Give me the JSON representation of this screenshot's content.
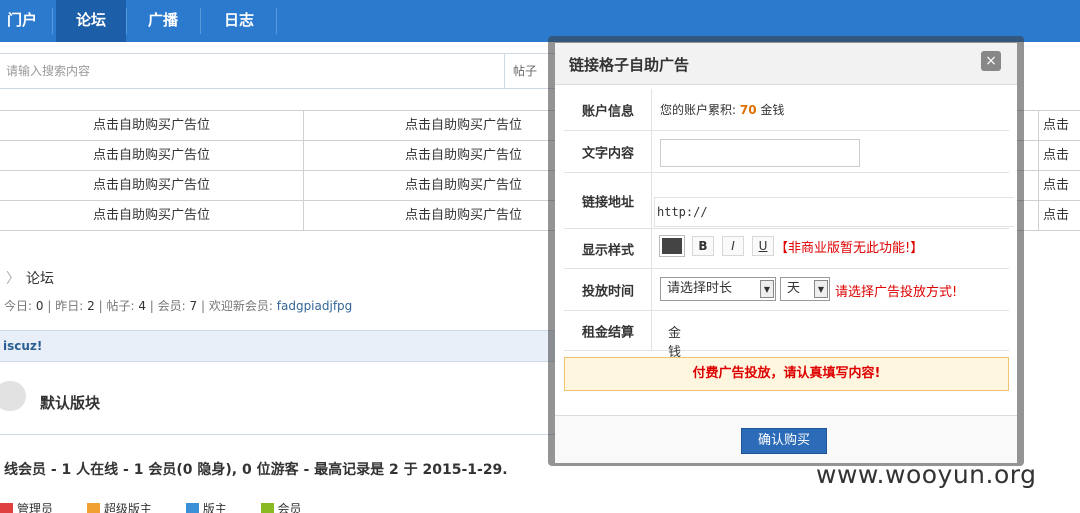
{
  "nav": {
    "items": [
      {
        "label": "门户"
      },
      {
        "label": "论坛"
      },
      {
        "label": "广播"
      },
      {
        "label": "日志"
      }
    ]
  },
  "search": {
    "placeholder": "请输入搜索内容",
    "scope": "帖子"
  },
  "ads": {
    "cell_label": "点击自助购买广告位",
    "cut_label": "点击"
  },
  "breadcrumb": {
    "current": "论坛"
  },
  "stats": {
    "today_label": "今日:",
    "today": "0",
    "yesterday_label": "昨日:",
    "yesterday": "2",
    "posts_label": "帖子:",
    "posts": "4",
    "members_label": "会员:",
    "members": "7",
    "welcome": "欢迎新会员:",
    "newest_member": "fadgpiadjfpg"
  },
  "category": {
    "title": "iscuz!"
  },
  "forum": {
    "name": "默认版块"
  },
  "online": {
    "text": "线会员 - 1 人在线 - 1 会员(0 隐身), 0 位游客 - 最高记录是 2 于 2015-1-29."
  },
  "legend": {
    "items": [
      {
        "label": "管理员",
        "color": "#e04040"
      },
      {
        "label": "超级版主",
        "color": "#f0a030"
      },
      {
        "label": "版主",
        "color": "#3a8fd6"
      },
      {
        "label": "会员",
        "color": "#88bb22"
      }
    ]
  },
  "modal": {
    "title": "链接格子自助广告",
    "close_glyph": "×",
    "account_label": "账户信息",
    "account_prefix": "您的账户累积:",
    "account_amount": "70",
    "account_unit": "金钱",
    "text_label": "文字内容",
    "text_value": "",
    "url_label": "链接地址",
    "url_value": "http://",
    "style_label": "显示样式",
    "bold": "B",
    "italic": "I",
    "underline": "U",
    "style_warning": "【非商业版暂无此功能!】",
    "time_label": "投放时间",
    "duration_placeholder": "请选择时长",
    "unit": "天",
    "time_hint": "请选择广告投放方式!",
    "rent_label": "租金结算",
    "rent_value": "金钱",
    "notice": "付费广告投放，请认真填写内容!",
    "confirm": "确认购买"
  },
  "watermark": "www.wooyun.org"
}
